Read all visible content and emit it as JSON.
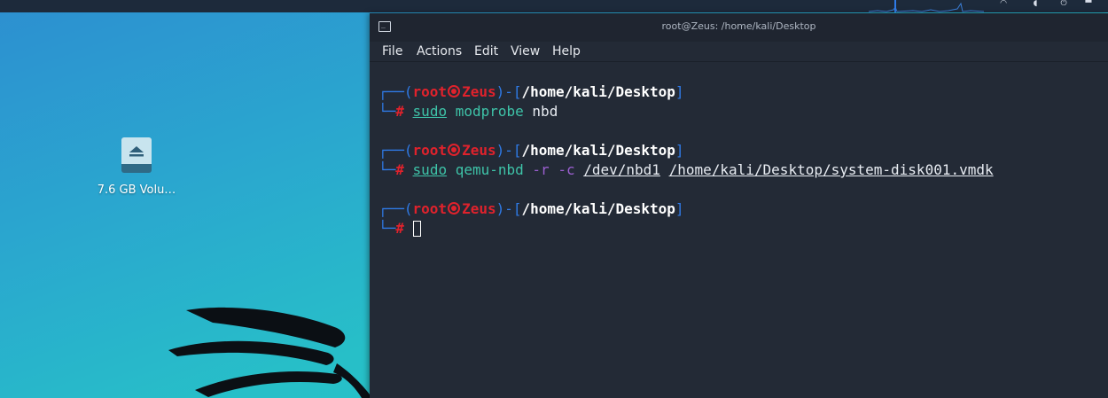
{
  "window": {
    "title": "root@Zeus: /home/kali/Desktop"
  },
  "menubar": {
    "items": [
      "File",
      "Actions",
      "Edit",
      "View",
      "Help"
    ]
  },
  "desktop": {
    "icon_label": "7.6 GB Volu…"
  },
  "prompt": {
    "open": "┌──(",
    "user": "root",
    "host": "Zeus",
    "mid": ")-[",
    "path": "/home/kali/Desktop",
    "close": "]",
    "second": "└─",
    "hash": "#"
  },
  "commands": [
    {
      "sudo": "sudo",
      "cmd": "modprobe",
      "rest": "nbd"
    },
    {
      "sudo": "sudo",
      "cmd": "qemu-nbd",
      "flags": "-r -c",
      "arg1": "/dev/nbd1",
      "arg2": "/home/kali/Desktop/system-disk001.vmdk"
    }
  ],
  "colors": {
    "prompt_blue": "#2f7be8",
    "prompt_red": "#e0222c",
    "command_green": "#3ec3a8",
    "flag_purple": "#9b5fd0",
    "terminal_bg": "#232a36"
  },
  "icons": {
    "terminal_app": "terminal-icon",
    "drive": "eject-drive-icon"
  }
}
